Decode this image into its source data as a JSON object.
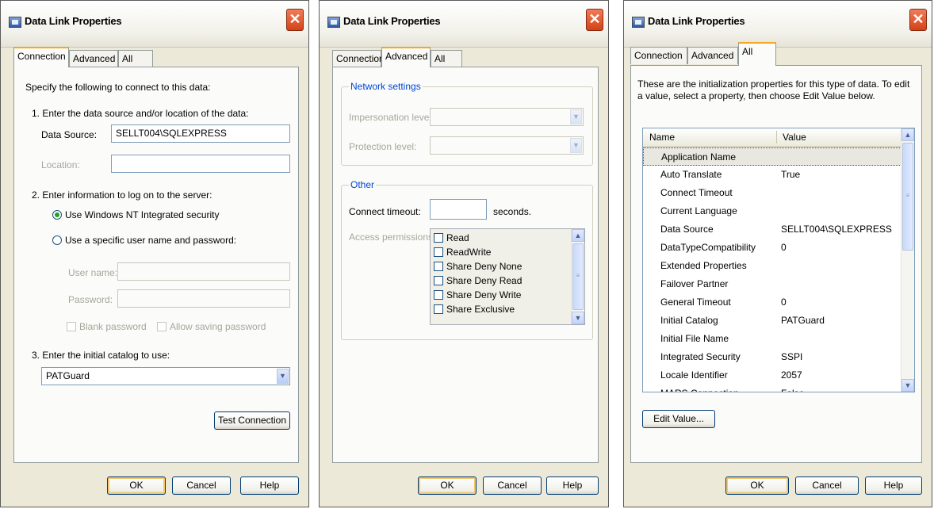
{
  "dialogs": {
    "connection": {
      "title": "Data Link Properties",
      "tabs": [
        "Connection",
        "Advanced",
        "All"
      ],
      "intro": "Specify the following to connect to this data:",
      "step1": "1. Enter the data source and/or location of the data:",
      "data_source_label": "Data Source:",
      "data_source_value": "SELLT004\\SQLEXPRESS",
      "location_label": "Location:",
      "location_value": "",
      "step2": "2. Enter information to log on to the server:",
      "radio_nt": "Use Windows NT Integrated security",
      "radio_specific": "Use a specific user name and password:",
      "username_label": "User name:",
      "password_label": "Password:",
      "blank_password": "Blank password",
      "allow_saving": "Allow saving password",
      "step3": "3. Enter the initial catalog to use:",
      "catalog_value": "PATGuard",
      "test_button": "Test Connection",
      "ok": "OK",
      "cancel": "Cancel",
      "help": "Help"
    },
    "advanced": {
      "title": "Data Link Properties",
      "tabs": [
        "Connection",
        "Advanced",
        "All"
      ],
      "network_group": "Network settings",
      "impersonation_label": "Impersonation level:",
      "protection_label": "Protection level:",
      "other_group": "Other",
      "timeout_label": "Connect timeout:",
      "timeout_value": "",
      "timeout_unit": "seconds.",
      "access_label": "Access permissions:",
      "permissions": [
        "Read",
        "ReadWrite",
        "Share Deny None",
        "Share Deny Read",
        "Share Deny Write",
        "Share Exclusive"
      ],
      "ok": "OK",
      "cancel": "Cancel",
      "help": "Help"
    },
    "all": {
      "title": "Data Link Properties",
      "tabs": [
        "Connection",
        "Advanced",
        "All"
      ],
      "intro": "These are the initialization properties for this type of data. To edit a value, select a property, then choose Edit Value below.",
      "col_name": "Name",
      "col_value": "Value",
      "properties": [
        {
          "name": "Application Name",
          "value": ""
        },
        {
          "name": "Auto Translate",
          "value": "True"
        },
        {
          "name": "Connect Timeout",
          "value": ""
        },
        {
          "name": "Current Language",
          "value": ""
        },
        {
          "name": "Data Source",
          "value": "SELLT004\\SQLEXPRESS"
        },
        {
          "name": "DataTypeCompatibility",
          "value": "0"
        },
        {
          "name": "Extended Properties",
          "value": ""
        },
        {
          "name": "Failover Partner",
          "value": ""
        },
        {
          "name": "General Timeout",
          "value": "0"
        },
        {
          "name": "Initial Catalog",
          "value": "PATGuard"
        },
        {
          "name": "Initial File Name",
          "value": ""
        },
        {
          "name": "Integrated Security",
          "value": "SSPI"
        },
        {
          "name": "Locale Identifier",
          "value": "2057"
        },
        {
          "name": "MARS Connection",
          "value": "False"
        }
      ],
      "edit_button": "Edit Value...",
      "ok": "OK",
      "cancel": "Cancel",
      "help": "Help"
    }
  }
}
